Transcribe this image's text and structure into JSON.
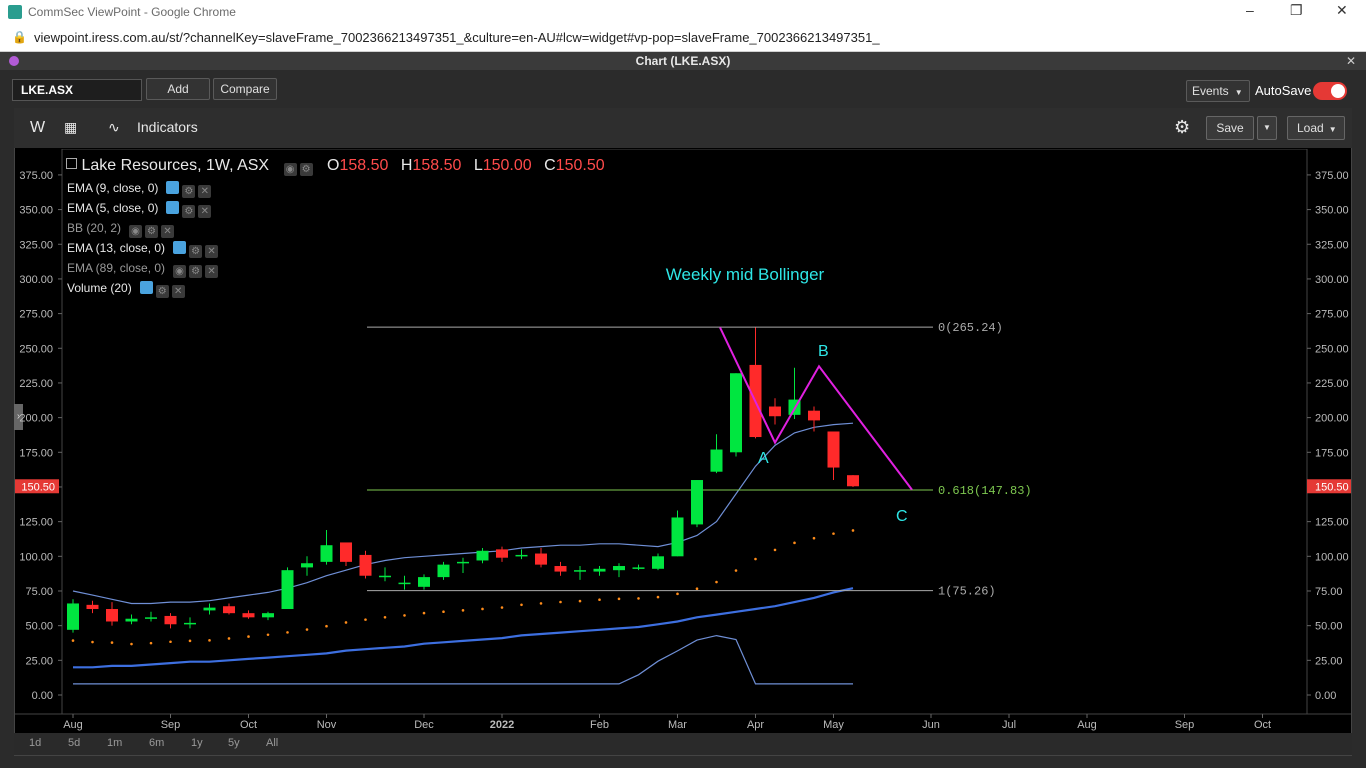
{
  "browser": {
    "title": "CommSec ViewPoint - Google Chrome",
    "url": "viewpoint.iress.com.au/st/?channelKey=slaveFrame_7002366213497351_&culture=en-AU#lcw=widget#vp-pop=slaveFrame_7002366213497351_"
  },
  "panel": {
    "title": "Chart (LKE.ASX)"
  },
  "toolbar": {
    "symbol": "LKE.ASX",
    "add_label": "Add",
    "compare_label": "Compare",
    "events_label": "Events",
    "autosave_label": "AutoSave",
    "autosave_on": true
  },
  "chart_toolbar": {
    "interval": "W",
    "indicators_label": "Indicators",
    "save_label": "Save",
    "load_label": "Load"
  },
  "legend": {
    "name": "Lake Resources, 1W, ASX",
    "o_label": "O",
    "o": "158.50",
    "h_label": "H",
    "h": "158.50",
    "l_label": "L",
    "l": "150.00",
    "c_label": "C",
    "c": "150.50",
    "studies": [
      "EMA (9, close, 0)",
      "EMA (5, close, 0)",
      "BB (20, 2)",
      "EMA (13, close, 0)",
      "EMA (89, close, 0)",
      "Volume (20)"
    ]
  },
  "periods": [
    "1d",
    "5d",
    "1m",
    "6m",
    "1y",
    "5y",
    "All"
  ],
  "colors": {
    "up": "#00e640",
    "down": "#ff2a2a",
    "bb": "#6f8fd6",
    "ema_thick": "#3d6fe0",
    "ema_dot": "#ff8c1a",
    "fib": "#aaaaaa",
    "fib_mid": "#7ec850",
    "abc": "#e020e0",
    "note": "#2ee6e6",
    "price_tag": "#e53935"
  },
  "chart_data": {
    "type": "candlestick",
    "title": "Weekly mid Bollinger",
    "y_axis": {
      "ylim": [
        -10,
        390
      ],
      "ticks": [
        "375.00",
        "350.00",
        "325.00",
        "300.00",
        "275.00",
        "250.00",
        "225.00",
        "200.00",
        "175.00",
        "150.00",
        "125.00",
        "100.00",
        "75.00",
        "50.00",
        "25.00",
        "0.00"
      ],
      "current_price": "150.50"
    },
    "x_axis": {
      "ticks": [
        "Aug",
        "Sep",
        "Oct",
        "Nov",
        "Dec",
        "2022",
        "Feb",
        "Mar",
        "Apr",
        "May",
        "Jun",
        "Jul",
        "Aug",
        "Sep",
        "Oct"
      ],
      "tick_weeks": [
        0,
        5,
        9,
        13,
        18,
        22,
        27,
        31,
        35,
        39,
        44,
        48,
        52,
        57,
        61
      ]
    },
    "candles": [
      {
        "o": 47,
        "h": 69,
        "l": 45,
        "c": 66
      },
      {
        "o": 65,
        "h": 68,
        "l": 59,
        "c": 62
      },
      {
        "o": 62,
        "h": 67,
        "l": 50,
        "c": 53
      },
      {
        "o": 53,
        "h": 58,
        "l": 51,
        "c": 55
      },
      {
        "o": 55,
        "h": 60,
        "l": 53,
        "c": 56
      },
      {
        "o": 57,
        "h": 59,
        "l": 48,
        "c": 51
      },
      {
        "o": 51,
        "h": 56,
        "l": 48,
        "c": 52
      },
      {
        "o": 61,
        "h": 66,
        "l": 58,
        "c": 63
      },
      {
        "o": 64,
        "h": 66,
        "l": 58,
        "c": 59
      },
      {
        "o": 59,
        "h": 61,
        "l": 55,
        "c": 56
      },
      {
        "o": 56,
        "h": 60,
        "l": 54,
        "c": 59
      },
      {
        "o": 62,
        "h": 92,
        "l": 62,
        "c": 90
      },
      {
        "o": 92,
        "h": 100,
        "l": 86,
        "c": 95
      },
      {
        "o": 96,
        "h": 119,
        "l": 94,
        "c": 108
      },
      {
        "o": 110,
        "h": 110,
        "l": 93,
        "c": 96
      },
      {
        "o": 101,
        "h": 104,
        "l": 84,
        "c": 86
      },
      {
        "o": 85,
        "h": 92,
        "l": 82,
        "c": 86
      },
      {
        "o": 80,
        "h": 86,
        "l": 76,
        "c": 81
      },
      {
        "o": 78,
        "h": 87,
        "l": 76,
        "c": 85
      },
      {
        "o": 85,
        "h": 96,
        "l": 83,
        "c": 94
      },
      {
        "o": 95,
        "h": 99,
        "l": 88,
        "c": 96
      },
      {
        "o": 97,
        "h": 106,
        "l": 95,
        "c": 104
      },
      {
        "o": 105,
        "h": 107,
        "l": 96,
        "c": 99
      },
      {
        "o": 100,
        "h": 105,
        "l": 98,
        "c": 101
      },
      {
        "o": 102,
        "h": 106,
        "l": 92,
        "c": 94
      },
      {
        "o": 93,
        "h": 96,
        "l": 86,
        "c": 89
      },
      {
        "o": 89,
        "h": 93,
        "l": 83,
        "c": 90
      },
      {
        "o": 89,
        "h": 93,
        "l": 86,
        "c": 91
      },
      {
        "o": 90,
        "h": 95,
        "l": 85,
        "c": 93
      },
      {
        "o": 91,
        "h": 94,
        "l": 90,
        "c": 92
      },
      {
        "o": 91,
        "h": 102,
        "l": 90,
        "c": 100
      },
      {
        "o": 100,
        "h": 133,
        "l": 100,
        "c": 128
      },
      {
        "o": 123,
        "h": 155,
        "l": 121,
        "c": 155
      },
      {
        "o": 161,
        "h": 188,
        "l": 160,
        "c": 177
      },
      {
        "o": 175,
        "h": 232,
        "l": 172,
        "c": 232
      },
      {
        "o": 238,
        "h": 265,
        "l": 185,
        "c": 186
      },
      {
        "o": 208,
        "h": 214,
        "l": 195,
        "c": 201
      },
      {
        "o": 202,
        "h": 236,
        "l": 199,
        "c": 213
      },
      {
        "o": 205,
        "h": 208,
        "l": 190,
        "c": 198
      },
      {
        "o": 190,
        "h": 190,
        "l": 155,
        "c": 164
      },
      {
        "o": 158.5,
        "h": 158.5,
        "l": 150,
        "c": 150.5
      }
    ],
    "series": [
      {
        "values": [
          75,
          72,
          69,
          66,
          66,
          67,
          67,
          68,
          70,
          72,
          74,
          77,
          81,
          86,
          90,
          94,
          97,
          99,
          100,
          101,
          102,
          103,
          104,
          106,
          107,
          108,
          108,
          109,
          109,
          108,
          107,
          110,
          115,
          125,
          145,
          165,
          180,
          189,
          193,
          195,
          196
        ]
      },
      {
        "values": [
          20,
          20,
          21,
          21,
          22,
          23,
          24,
          24,
          25,
          26,
          27,
          28,
          29,
          30,
          32,
          33,
          34,
          35,
          37,
          38,
          39,
          40,
          41,
          43,
          44,
          45,
          46,
          47,
          48,
          49,
          51,
          53,
          56,
          58,
          60,
          62,
          64,
          67,
          70,
          74,
          77
        ]
      }
    ],
    "fib_levels": [
      {
        "label": "0(265.24)",
        "value": 265.24
      },
      {
        "label": "0.618(147.83)",
        "value": 147.83
      },
      {
        "label": "1(75.26)",
        "value": 75.26
      }
    ],
    "wave_labels": [
      "A",
      "B",
      "C"
    ]
  }
}
